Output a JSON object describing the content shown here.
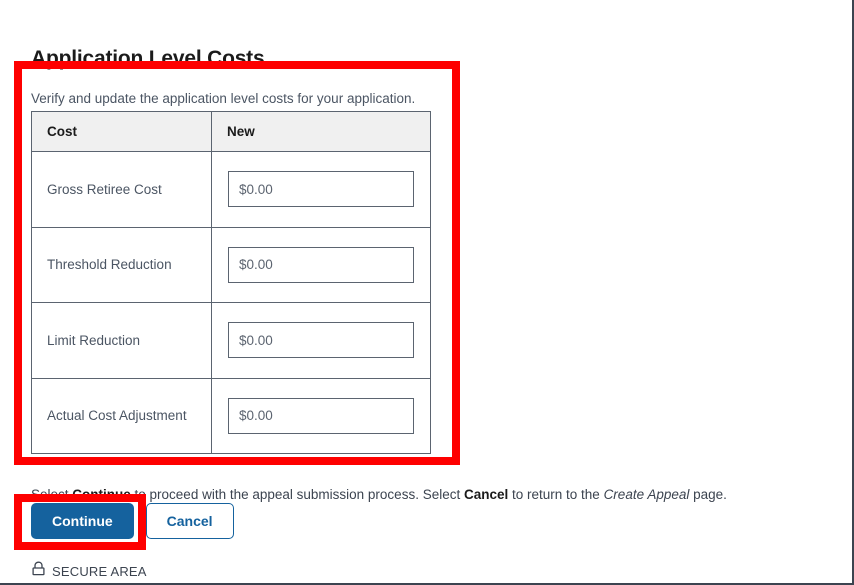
{
  "page": {
    "title": "Application Level Costs",
    "intro": "Verify and update the application level costs for your application."
  },
  "table": {
    "headers": [
      "Cost",
      "New"
    ],
    "rows": [
      {
        "label": "Gross Retiree Cost",
        "value": "$0.00"
      },
      {
        "label": "Threshold Reduction",
        "value": "$0.00"
      },
      {
        "label": "Limit Reduction",
        "value": "$0.00"
      },
      {
        "label": "Actual Cost Adjustment",
        "value": "$0.00"
      }
    ]
  },
  "helper": {
    "part1": "Select ",
    "bold1": "Continue",
    "part2": " to proceed with the appeal submission process. Select ",
    "bold2": "Cancel",
    "part3": " to return to the ",
    "italic1": "Create Appeal",
    "part4": " page."
  },
  "buttons": {
    "continue_label": "Continue",
    "cancel_label": "Cancel"
  },
  "footer": {
    "secure_label": "SECURE AREA",
    "lock_icon": "padlock-icon"
  },
  "colors": {
    "primary_blue": "#15629e",
    "annotation_red": "#fe0000",
    "table_header_bg": "#f0f0f0",
    "border_gray": "#5b6470"
  },
  "annotations": [
    {
      "name": "table-highlight",
      "shape": "rectangle",
      "color": "#fe0000"
    },
    {
      "name": "continue-button-highlight",
      "shape": "rectangle",
      "color": "#fe0000"
    }
  ]
}
